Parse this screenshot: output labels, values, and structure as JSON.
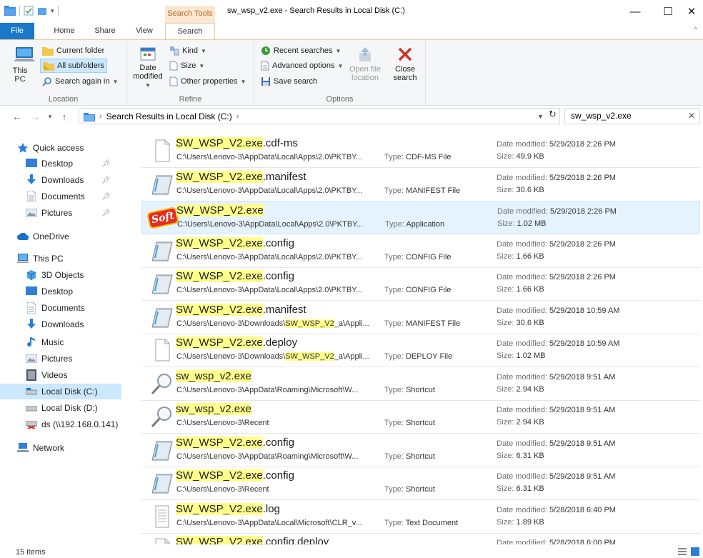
{
  "window": {
    "title": "sw_wsp_v2.exe - Search Results in Local Disk (C:)",
    "context_tab": "Search Tools",
    "minimize": "—",
    "maximize": "☐",
    "close": "✕"
  },
  "tabs": {
    "file": "File",
    "home": "Home",
    "share": "Share",
    "view": "View",
    "search": "Search",
    "collapse": "^"
  },
  "ribbon": {
    "location": {
      "label": "Location",
      "this_pc": "This PC",
      "current_folder": "Current folder",
      "all_subfolders": "All subfolders",
      "search_again_in": "Search again in"
    },
    "refine": {
      "label": "Refine",
      "date_modified_1": "Date",
      "date_modified_2": "modified",
      "kind": "Kind",
      "size": "Size",
      "other_properties": "Other properties"
    },
    "options": {
      "label": "Options",
      "recent_searches": "Recent searches",
      "advanced_options": "Advanced options",
      "save_search": "Save search",
      "open_file_location_1": "Open file",
      "open_file_location_2": "location",
      "close_search_1": "Close",
      "close_search_2": "search"
    }
  },
  "address": {
    "path": "Search Results in Local Disk (C:)",
    "search_value": "sw_wsp_v2.exe"
  },
  "nav": {
    "quick_access": "Quick access",
    "qa_items": [
      "Desktop",
      "Downloads",
      "Documents",
      "Pictures"
    ],
    "onedrive": "OneDrive",
    "this_pc": "This PC",
    "pc_items": [
      "3D Objects",
      "Desktop",
      "Documents",
      "Downloads",
      "Music",
      "Pictures",
      "Videos",
      "Local Disk (C:)",
      "Local Disk (D:)",
      "ds (\\\\192.168.0.141)"
    ],
    "network": "Network"
  },
  "labels": {
    "type": "Type:",
    "date_modified": "Date modified:",
    "size": "Size:"
  },
  "results": [
    {
      "hl": "SW_WSP_V2.exe",
      "rest": ".cdf-ms",
      "path_a": "C:\\Users\\Lenovo-3\\AppData\\Local\\Apps\\2.0\\PKTBY...",
      "path_hl": "",
      "path_b": "",
      "type": "CDF-MS File",
      "date": "5/29/2018 2:26 PM",
      "size": "49.9 KB",
      "icon": "blank"
    },
    {
      "hl": "SW_WSP_V2.exe",
      "rest": ".manifest",
      "path_a": "C:\\Users\\Lenovo-3\\AppData\\Local\\Apps\\2.0\\PKTBY...",
      "path_hl": "",
      "path_b": "",
      "type": "MANIFEST File",
      "date": "5/29/2018 2:26 PM",
      "size": "30.6 KB",
      "icon": "config"
    },
    {
      "hl": "SW_WSP_V2.exe",
      "rest": "",
      "path_a": "C:\\Users\\Lenovo-3\\AppData\\Local\\Apps\\2.0\\PKTBY...",
      "path_hl": "",
      "path_b": "",
      "type": "Application",
      "date": "5/29/2018 2:26 PM",
      "size": "1.02 MB",
      "icon": "app",
      "app_badge": "Soft"
    },
    {
      "hl": "SW_WSP_V2.exe",
      "rest": ".config",
      "path_a": "C:\\Users\\Lenovo-3\\AppData\\Local\\Apps\\2.0\\PKTBY...",
      "path_hl": "",
      "path_b": "",
      "type": "CONFIG File",
      "date": "5/29/2018 2:26 PM",
      "size": "1.66 KB",
      "icon": "config"
    },
    {
      "hl": "SW_WSP_V2.exe",
      "rest": ".config",
      "path_a": "C:\\Users\\Lenovo-3\\AppData\\Local\\Apps\\2.0\\PKTBY...",
      "path_hl": "",
      "path_b": "",
      "type": "CONFIG File",
      "date": "5/29/2018 2:26 PM",
      "size": "1.66 KB",
      "icon": "config"
    },
    {
      "hl": "SW_WSP_V2.exe",
      "rest": ".manifest",
      "path_a": "C:\\Users\\Lenovo-3\\Downloads\\",
      "path_hl": "SW_WSP_V2",
      "path_b": "_a\\Appli...",
      "type": "MANIFEST File",
      "date": "5/29/2018 10:59 AM",
      "size": "30.6 KB",
      "icon": "config"
    },
    {
      "hl": "SW_WSP_V2.exe",
      "rest": ".deploy",
      "path_a": "C:\\Users\\Lenovo-3\\Downloads\\",
      "path_hl": "SW_WSP_V2",
      "path_b": "_a\\Appli...",
      "type": "DEPLOY File",
      "date": "5/29/2018 10:59 AM",
      "size": "1.02 MB",
      "icon": "blank"
    },
    {
      "hl": "sw_wsp_v2.exe",
      "rest": "",
      "path_a": "C:\\Users\\Lenovo-3\\AppData\\Roaming\\Microsoft\\W...",
      "path_hl": "",
      "path_b": "",
      "type": "Shortcut",
      "date": "5/29/2018 9:51 AM",
      "size": "2.94 KB",
      "icon": "search"
    },
    {
      "hl": "sw_wsp_v2.exe",
      "rest": "",
      "path_a": "C:\\Users\\Lenovo-3\\Recent",
      "path_hl": "",
      "path_b": "",
      "type": "Shortcut",
      "date": "5/29/2018 9:51 AM",
      "size": "2.94 KB",
      "icon": "search"
    },
    {
      "hl": "SW_WSP_V2.exe",
      "rest": ".config",
      "path_a": "C:\\Users\\Lenovo-3\\AppData\\Roaming\\Microsoft\\W...",
      "path_hl": "",
      "path_b": "",
      "type": "Shortcut",
      "date": "5/29/2018 9:51 AM",
      "size": "6.31 KB",
      "icon": "config"
    },
    {
      "hl": "SW_WSP_V2.exe",
      "rest": ".config",
      "path_a": "C:\\Users\\Lenovo-3\\Recent",
      "path_hl": "",
      "path_b": "",
      "type": "Shortcut",
      "date": "5/29/2018 9:51 AM",
      "size": "6.31 KB",
      "icon": "config"
    },
    {
      "hl": "SW_WSP_V2.exe",
      "rest": ".log",
      "path_a": "C:\\Users\\Lenovo-3\\AppData\\Local\\Microsoft\\CLR_v...",
      "path_hl": "",
      "path_b": "",
      "type": "Text Document",
      "date": "5/28/2018 6:40 PM",
      "size": "1.89 KB",
      "icon": "text"
    },
    {
      "hl": "SW_WSP_V2.exe",
      "rest": ".config.deploy",
      "path_a": "",
      "path_hl": "",
      "path_b": "",
      "type": "",
      "date": "5/28/2018 6:00 PM",
      "size": "",
      "icon": "blank"
    }
  ],
  "status": {
    "count": "15 items"
  },
  "colors": {
    "accent": "#1979ca",
    "highlight": "#ffff8c",
    "selection": "#cce8ff",
    "context_tab": "#fbe7cf"
  }
}
